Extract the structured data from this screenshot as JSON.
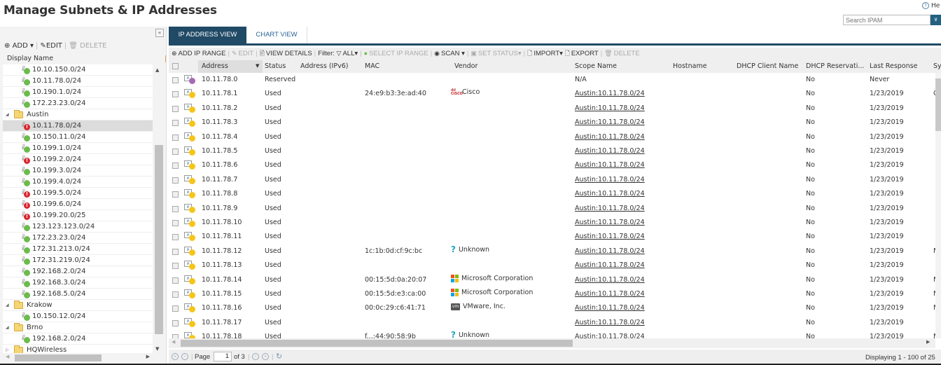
{
  "header": {
    "title": "Manage Subnets & IP Addresses",
    "help_label": "He",
    "search_placeholder": "Search IPAM"
  },
  "left_panel": {
    "collapse_icon": "double-chevron-left-icon",
    "toolbar": {
      "add": "ADD",
      "edit": "EDIT",
      "delete": "DELETE"
    },
    "column_header": "Display Name",
    "tree": [
      {
        "type": "subnet",
        "label": "10.10.150.0/24",
        "status": "ok"
      },
      {
        "type": "subnet",
        "label": "10.11.78.0/24",
        "status": "ok"
      },
      {
        "type": "subnet",
        "label": "10.190.1.0/24",
        "status": "ok"
      },
      {
        "type": "subnet",
        "label": "172.23.23.0/24",
        "status": "ok"
      },
      {
        "type": "group",
        "label": "Austin",
        "expanded": true
      },
      {
        "type": "subnet",
        "label": "10.11.78.0/24",
        "status": "critical",
        "selected": true
      },
      {
        "type": "subnet",
        "label": "10.150.11.0/24",
        "status": "ok"
      },
      {
        "type": "subnet",
        "label": "10.199.1.0/24",
        "status": "ok"
      },
      {
        "type": "subnet",
        "label": "10.199.2.0/24",
        "status": "critical"
      },
      {
        "type": "subnet",
        "label": "10.199.3.0/24",
        "status": "ok"
      },
      {
        "type": "subnet",
        "label": "10.199.4.0/24",
        "status": "ok"
      },
      {
        "type": "subnet",
        "label": "10.199.5.0/24",
        "status": "critical"
      },
      {
        "type": "subnet",
        "label": "10.199.6.0/24",
        "status": "critical"
      },
      {
        "type": "subnet",
        "label": "10.199.20.0/25",
        "status": "critical"
      },
      {
        "type": "subnet",
        "label": "123.123.123.0/24",
        "status": "ok"
      },
      {
        "type": "subnet",
        "label": "172.23.23.0/24",
        "status": "ok"
      },
      {
        "type": "subnet",
        "label": "172.31.213.0/24",
        "status": "ok"
      },
      {
        "type": "subnet",
        "label": "172.31.219.0/24",
        "status": "ok"
      },
      {
        "type": "subnet",
        "label": "192.168.2.0/24",
        "status": "ok"
      },
      {
        "type": "subnet",
        "label": "192.168.3.0/24",
        "status": "ok"
      },
      {
        "type": "subnet",
        "label": "192.168.5.0/24",
        "status": "ok"
      },
      {
        "type": "group",
        "label": "Krakow",
        "expanded": true
      },
      {
        "type": "subnet",
        "label": "10.150.12.0/24",
        "status": "ok"
      },
      {
        "type": "group",
        "label": "Brno",
        "expanded": true
      },
      {
        "type": "subnet",
        "label": "192.168.2.0/24",
        "status": "ok"
      },
      {
        "type": "group",
        "label": "HQWireless",
        "expanded": false
      }
    ]
  },
  "tabs": [
    {
      "label": "IP ADDRESS VIEW",
      "active": true
    },
    {
      "label": "CHART VIEW",
      "active": false
    }
  ],
  "toolbar": {
    "add_ip_range": "ADD IP RANGE",
    "edit": "EDIT",
    "view_details": "VIEW DETAILS",
    "filter_label": "Filter:",
    "filter_value": "ALL",
    "select_ip_range": "SELECT IP RANGE",
    "scan": "SCAN",
    "set_status": "SET STATUS",
    "import": "IMPORT",
    "export": "EXPORT",
    "delete": "DELETE"
  },
  "grid": {
    "columns": [
      "Address",
      "Status",
      "Address (IPv6)",
      "MAC",
      "Vendor",
      "Scope Name",
      "Hostname",
      "DHCP Client Name",
      "DHCP Reservati...",
      "Last Response",
      "Sy"
    ],
    "rows": [
      {
        "address": "10.11.78.0",
        "status": "Reserved",
        "state": "reserved",
        "mac": "",
        "vendor": "",
        "vendor_icon": "",
        "scope": "N/A",
        "scope_link": false,
        "dhcp_res": "No",
        "last_response": "Never",
        "sys": ""
      },
      {
        "address": "10.11.78.1",
        "status": "Used",
        "state": "used",
        "mac": "24:e9:b3:3e:ad:40",
        "vendor": "Cisco",
        "vendor_icon": "cisco",
        "scope": "Austin:10.11.78.0/24",
        "scope_link": true,
        "dhcp_res": "No",
        "last_response": "1/23/2019",
        "sys": "C"
      },
      {
        "address": "10.11.78.2",
        "status": "Used",
        "state": "used",
        "mac": "",
        "vendor": "",
        "vendor_icon": "",
        "scope": "Austin:10.11.78.0/24",
        "scope_link": true,
        "dhcp_res": "No",
        "last_response": "1/23/2019",
        "sys": ""
      },
      {
        "address": "10.11.78.3",
        "status": "Used",
        "state": "used",
        "mac": "",
        "vendor": "",
        "vendor_icon": "",
        "scope": "Austin:10.11.78.0/24",
        "scope_link": true,
        "dhcp_res": "No",
        "last_response": "1/23/2019",
        "sys": ""
      },
      {
        "address": "10.11.78.4",
        "status": "Used",
        "state": "used",
        "mac": "",
        "vendor": "",
        "vendor_icon": "",
        "scope": "Austin:10.11.78.0/24",
        "scope_link": true,
        "dhcp_res": "No",
        "last_response": "1/23/2019",
        "sys": ""
      },
      {
        "address": "10.11.78.5",
        "status": "Used",
        "state": "used",
        "mac": "",
        "vendor": "",
        "vendor_icon": "",
        "scope": "Austin:10.11.78.0/24",
        "scope_link": true,
        "dhcp_res": "No",
        "last_response": "1/23/2019",
        "sys": ""
      },
      {
        "address": "10.11.78.6",
        "status": "Used",
        "state": "used",
        "mac": "",
        "vendor": "",
        "vendor_icon": "",
        "scope": "Austin:10.11.78.0/24",
        "scope_link": true,
        "dhcp_res": "No",
        "last_response": "1/23/2019",
        "sys": ""
      },
      {
        "address": "10.11.78.7",
        "status": "Used",
        "state": "used",
        "mac": "",
        "vendor": "",
        "vendor_icon": "",
        "scope": "Austin:10.11.78.0/24",
        "scope_link": true,
        "dhcp_res": "No",
        "last_response": "1/23/2019",
        "sys": ""
      },
      {
        "address": "10.11.78.8",
        "status": "Used",
        "state": "used",
        "mac": "",
        "vendor": "",
        "vendor_icon": "",
        "scope": "Austin:10.11.78.0/24",
        "scope_link": true,
        "dhcp_res": "No",
        "last_response": "1/23/2019",
        "sys": ""
      },
      {
        "address": "10.11.78.9",
        "status": "Used",
        "state": "used",
        "mac": "",
        "vendor": "",
        "vendor_icon": "",
        "scope": "Austin:10.11.78.0/24",
        "scope_link": true,
        "dhcp_res": "No",
        "last_response": "1/23/2019",
        "sys": ""
      },
      {
        "address": "10.11.78.10",
        "status": "Used",
        "state": "used",
        "mac": "",
        "vendor": "",
        "vendor_icon": "",
        "scope": "Austin:10.11.78.0/24",
        "scope_link": true,
        "dhcp_res": "No",
        "last_response": "1/23/2019",
        "sys": ""
      },
      {
        "address": "10.11.78.11",
        "status": "Used",
        "state": "used",
        "mac": "",
        "vendor": "",
        "vendor_icon": "",
        "scope": "Austin:10.11.78.0/24",
        "scope_link": true,
        "dhcp_res": "No",
        "last_response": "1/23/2019",
        "sys": ""
      },
      {
        "address": "10.11.78.12",
        "status": "Used",
        "state": "used",
        "mac": "1c:1b:0d:cf:9c:bc",
        "vendor": "Unknown",
        "vendor_icon": "unknown",
        "scope": "Austin:10.11.78.0/24",
        "scope_link": true,
        "dhcp_res": "No",
        "last_response": "1/23/2019",
        "sys": "M"
      },
      {
        "address": "10.11.78.13",
        "status": "Used",
        "state": "used",
        "mac": "",
        "vendor": "",
        "vendor_icon": "",
        "scope": "Austin:10.11.78.0/24",
        "scope_link": true,
        "dhcp_res": "No",
        "last_response": "1/23/2019",
        "sys": ""
      },
      {
        "address": "10.11.78.14",
        "status": "Used",
        "state": "used",
        "mac": "00:15:5d:0a:20:07",
        "vendor": "Microsoft Corporation",
        "vendor_icon": "microsoft",
        "scope": "Austin:10.11.78.0/24",
        "scope_link": true,
        "dhcp_res": "No",
        "last_response": "1/23/2019",
        "sys": "M"
      },
      {
        "address": "10.11.78.15",
        "status": "Used",
        "state": "used",
        "mac": "00:15:5d:e3:ca:00",
        "vendor": "Microsoft Corporation",
        "vendor_icon": "microsoft",
        "scope": "Austin:10.11.78.0/24",
        "scope_link": true,
        "dhcp_res": "No",
        "last_response": "1/23/2019",
        "sys": "M"
      },
      {
        "address": "10.11.78.16",
        "status": "Used",
        "state": "used",
        "mac": "00:0c:29:c6:41:71",
        "vendor": "VMware, Inc.",
        "vendor_icon": "vmware",
        "scope": "Austin:10.11.78.0/24",
        "scope_link": true,
        "dhcp_res": "No",
        "last_response": "1/23/2019",
        "sys": "M"
      },
      {
        "address": "10.11.78.17",
        "status": "Used",
        "state": "used",
        "mac": "",
        "vendor": "",
        "vendor_icon": "",
        "scope": "Austin:10.11.78.0/24",
        "scope_link": true,
        "dhcp_res": "No",
        "last_response": "1/23/2019",
        "sys": ""
      },
      {
        "address": "10.11.78.18",
        "status": "Used",
        "state": "used",
        "mac": "f...:44:90:58:9b",
        "vendor": "Unknown",
        "vendor_icon": "unknown",
        "scope": "Austin:10.11.78.0/24",
        "scope_link": true,
        "dhcp_res": "No",
        "last_response": "1/23/2019",
        "sys": "M"
      }
    ]
  },
  "pager": {
    "page_label": "Page",
    "current_page": "1",
    "of_label": "of 3",
    "display_text": "Displaying 1 - 100 of 25"
  }
}
